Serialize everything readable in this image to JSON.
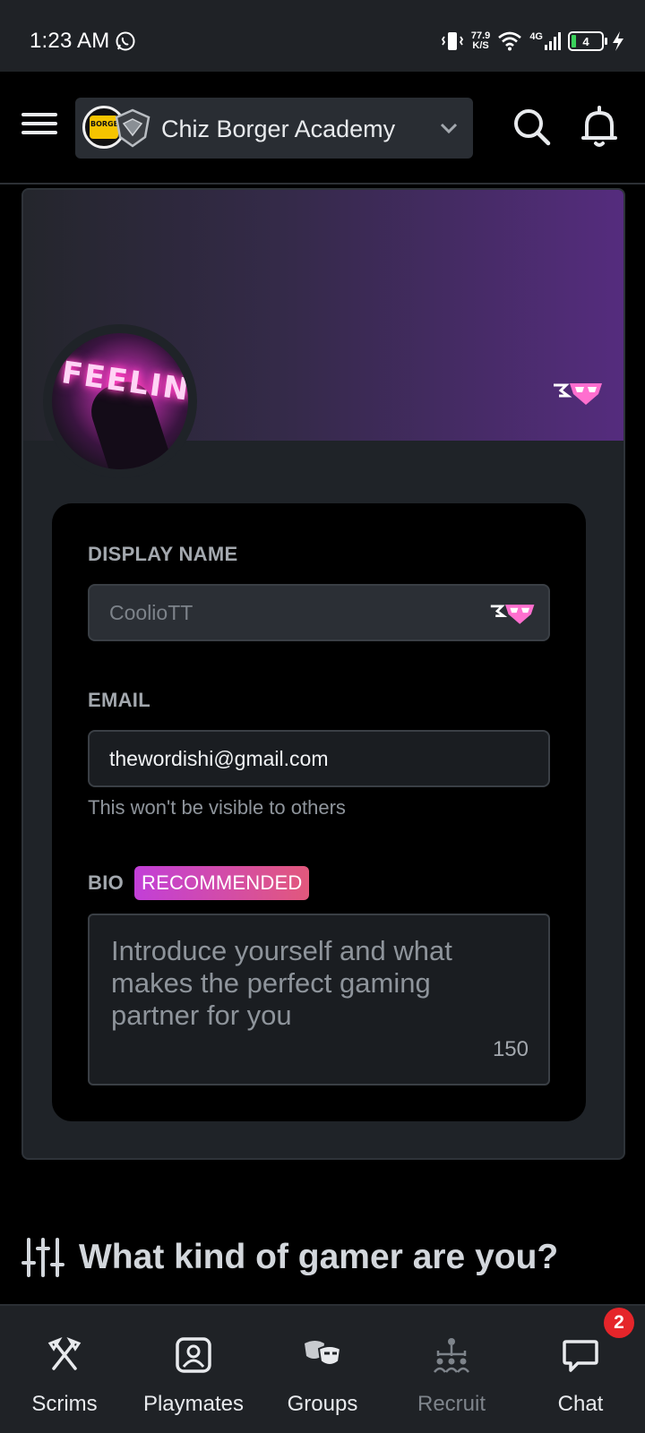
{
  "status_bar": {
    "time": "1:23 AM",
    "net_speed_value": "77.9",
    "net_speed_unit": "K/S",
    "network_type": "4G",
    "battery_level": "4"
  },
  "header": {
    "group_name": "Chiz Borger Academy",
    "group_logo_text": "BORGER"
  },
  "profile": {
    "avatar_text": "FEELINGS",
    "display_name": {
      "label": "DISPLAY NAME",
      "value": "CoolioTT"
    },
    "email": {
      "label": "EMAIL",
      "value": "thewordishi@gmail.com",
      "helper": "This won't be visible to others"
    },
    "bio": {
      "label": "BIO",
      "badge": "RECOMMENDED",
      "placeholder": "Introduce yourself and what makes the perfect gaming partner for you",
      "char_count": "150"
    }
  },
  "section": {
    "title": "What kind of gamer are you?"
  },
  "bottom_nav": {
    "items": [
      {
        "label": "Scrims",
        "icon": "crossed-axes-icon"
      },
      {
        "label": "Playmates",
        "icon": "profile-card-icon"
      },
      {
        "label": "Groups",
        "icon": "masks-icon"
      },
      {
        "label": "Recruit",
        "icon": "team-tree-icon",
        "disabled": true
      },
      {
        "label": "Chat",
        "icon": "chat-bubble-icon"
      }
    ],
    "chat_badge_count": "2"
  },
  "colors": {
    "accent_gradient_start": "#c23fd8",
    "accent_gradient_end": "#e2587c",
    "badge_red": "#e5252a",
    "banner_purple": "#552c7e"
  }
}
